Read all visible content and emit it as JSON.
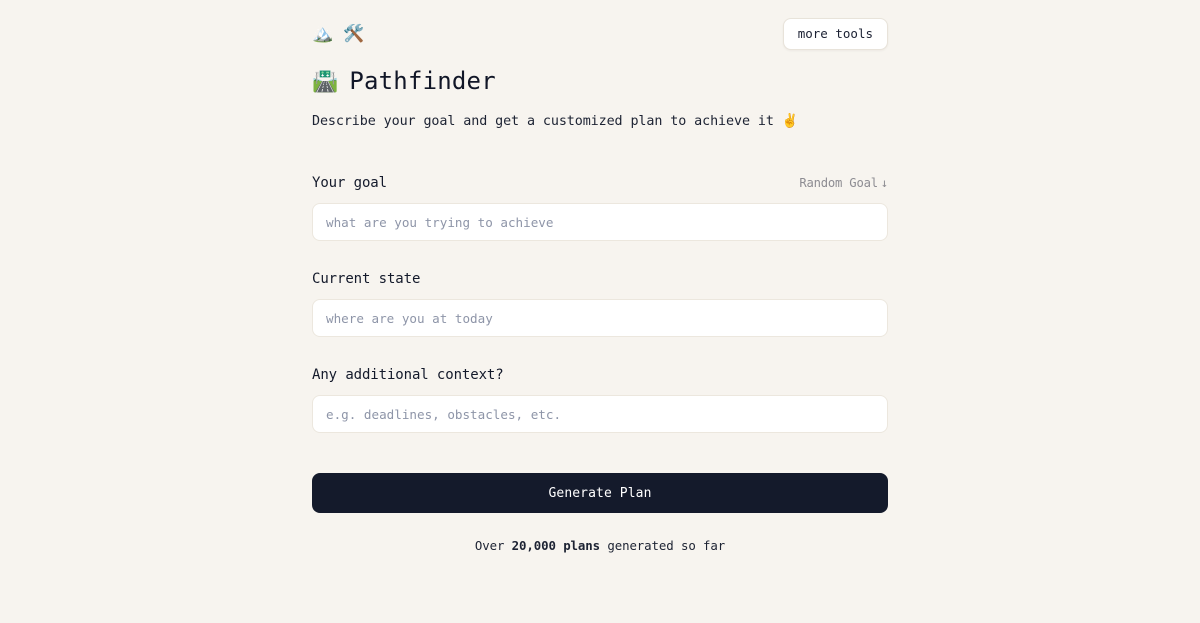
{
  "topbar": {
    "icons": [
      {
        "name": "mountain-icon",
        "glyph": "🏔️"
      },
      {
        "name": "hammer-and-wrench-icon",
        "glyph": "🛠️"
      }
    ],
    "more_tools_label": "more tools"
  },
  "header": {
    "title_emoji": "🛣️",
    "title": "Pathfinder",
    "subtitle_text": "Describe your goal and get a customized plan to achieve it",
    "subtitle_emoji": "✌️"
  },
  "form": {
    "fields": [
      {
        "label": "Your goal",
        "placeholder": "what are you trying to achieve",
        "value": "",
        "action_label": "Random Goal",
        "action_arrow": "↓"
      },
      {
        "label": "Current state",
        "placeholder": "where are you at today",
        "value": ""
      },
      {
        "label": "Any additional context?",
        "placeholder": "e.g. deadlines, obstacles, etc.",
        "value": ""
      }
    ],
    "submit_label": "Generate Plan"
  },
  "footer": {
    "counter_prefix": "Over ",
    "counter_highlight": "20,000 plans",
    "counter_suffix": " generated so far"
  },
  "colors": {
    "background": "#f7f4ef",
    "button": "#141a2b",
    "text": "#141a2b",
    "muted": "#8d8c92",
    "placeholder": "#8e95a8",
    "card": "#ffffff"
  }
}
